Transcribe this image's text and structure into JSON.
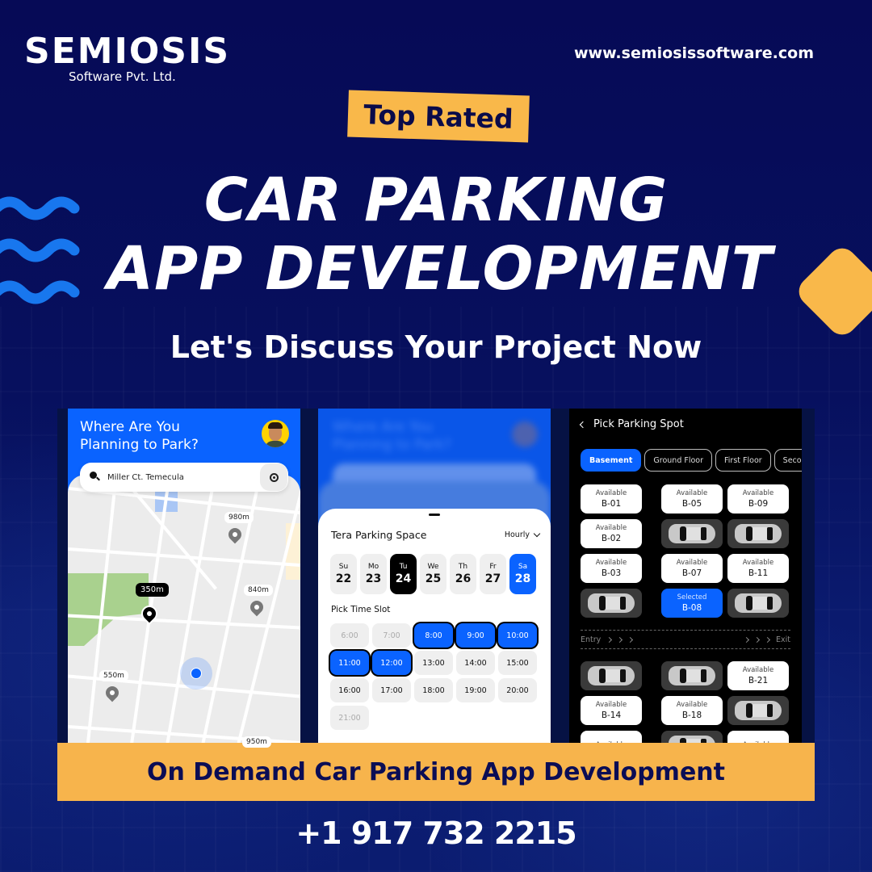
{
  "brand": {
    "name": "SEMIOSIS",
    "tagline": "Software Pvt. Ltd.",
    "website": "www.semiosissoftware.com",
    "colors": {
      "navy": "#060b58",
      "accent_yellow": "#f9b84a",
      "accent_blue": "#0a63ff"
    }
  },
  "hero": {
    "badge": "Top Rated",
    "title_line1": "CAR PARKING",
    "title_line2": "APP DEVELOPMENT",
    "subtitle": "Let's Discuss Your Project Now"
  },
  "screen_map": {
    "title": "Where Are You Planning to Park?",
    "search_value": "Miller Ct. Temecula",
    "icons": [
      "avatar",
      "search-icon",
      "locate-icon"
    ],
    "markers": [
      {
        "distance": "980m",
        "active": false
      },
      {
        "distance": "350m",
        "active": true
      },
      {
        "distance": "840m",
        "active": false
      },
      {
        "distance": "550m",
        "active": false
      },
      {
        "distance": "950m",
        "active": false
      }
    ]
  },
  "screen_booking": {
    "background_title": "Where Are You Planning to Park?",
    "sheet_title": "Tera Parking Space",
    "rate_option": "Hourly",
    "days": [
      {
        "name": "Su",
        "date": "22",
        "state": "normal"
      },
      {
        "name": "Mo",
        "date": "23",
        "state": "normal"
      },
      {
        "name": "Tu",
        "date": "24",
        "state": "today"
      },
      {
        "name": "We",
        "date": "25",
        "state": "normal"
      },
      {
        "name": "Th",
        "date": "26",
        "state": "normal"
      },
      {
        "name": "Fr",
        "date": "27",
        "state": "normal"
      },
      {
        "name": "Sa",
        "date": "28",
        "state": "selected"
      }
    ],
    "slot_heading": "Pick Time Slot",
    "slots": [
      {
        "time": "6:00",
        "state": "disabled"
      },
      {
        "time": "7:00",
        "state": "disabled"
      },
      {
        "time": "8:00",
        "state": "picked"
      },
      {
        "time": "9:00",
        "state": "picked"
      },
      {
        "time": "10:00",
        "state": "picked"
      },
      {
        "time": "11:00",
        "state": "picked"
      },
      {
        "time": "12:00",
        "state": "picked"
      },
      {
        "time": "13:00",
        "state": "available"
      },
      {
        "time": "14:00",
        "state": "available"
      },
      {
        "time": "15:00",
        "state": "available"
      },
      {
        "time": "16:00",
        "state": "available"
      },
      {
        "time": "17:00",
        "state": "available"
      },
      {
        "time": "18:00",
        "state": "available"
      },
      {
        "time": "19:00",
        "state": "available"
      },
      {
        "time": "20:00",
        "state": "available"
      },
      {
        "time": "21:00",
        "state": "disabled"
      }
    ]
  },
  "screen_spots": {
    "title": "Pick Parking Spot",
    "floors": [
      {
        "label": "Basement",
        "active": true
      },
      {
        "label": "Ground Floor",
        "active": false
      },
      {
        "label": "First Floor",
        "active": false
      },
      {
        "label": "Secon",
        "active": false
      }
    ],
    "status_available": "Available",
    "status_selected": "Selected",
    "lane_entry": "Entry",
    "lane_exit": "Exit",
    "upper_spots": [
      {
        "col": 0,
        "row": 0,
        "id": "B-01",
        "state": "available"
      },
      {
        "col": 1,
        "row": 0,
        "id": "B-05",
        "state": "available"
      },
      {
        "col": 2,
        "row": 0,
        "id": "B-09",
        "state": "available"
      },
      {
        "col": 0,
        "row": 1,
        "id": "B-02",
        "state": "available"
      },
      {
        "col": 1,
        "row": 1,
        "id": "",
        "state": "occupied"
      },
      {
        "col": 2,
        "row": 1,
        "id": "",
        "state": "occupied"
      },
      {
        "col": 0,
        "row": 2,
        "id": "B-03",
        "state": "available"
      },
      {
        "col": 1,
        "row": 2,
        "id": "B-07",
        "state": "available"
      },
      {
        "col": 2,
        "row": 2,
        "id": "B-11",
        "state": "available"
      },
      {
        "col": 0,
        "row": 3,
        "id": "",
        "state": "occupied"
      },
      {
        "col": 1,
        "row": 3,
        "id": "B-08",
        "state": "selected"
      },
      {
        "col": 2,
        "row": 3,
        "id": "",
        "state": "occupied"
      }
    ],
    "lower_spots": [
      {
        "col": 0,
        "row": 0,
        "id": "",
        "state": "occupied"
      },
      {
        "col": 1,
        "row": 0,
        "id": "",
        "state": "occupied"
      },
      {
        "col": 2,
        "row": 0,
        "id": "B-21",
        "state": "available"
      },
      {
        "col": 0,
        "row": 1,
        "id": "B-14",
        "state": "available"
      },
      {
        "col": 1,
        "row": 1,
        "id": "B-18",
        "state": "available"
      },
      {
        "col": 2,
        "row": 1,
        "id": "",
        "state": "occupied"
      },
      {
        "col": 0,
        "row": 2,
        "id": "",
        "state": "available"
      },
      {
        "col": 1,
        "row": 2,
        "id": "",
        "state": "occupied"
      },
      {
        "col": 2,
        "row": 2,
        "id": "",
        "state": "available"
      }
    ]
  },
  "footer": {
    "cta": "On Demand Car Parking App Development",
    "phone": "+1 917 732 2215"
  }
}
